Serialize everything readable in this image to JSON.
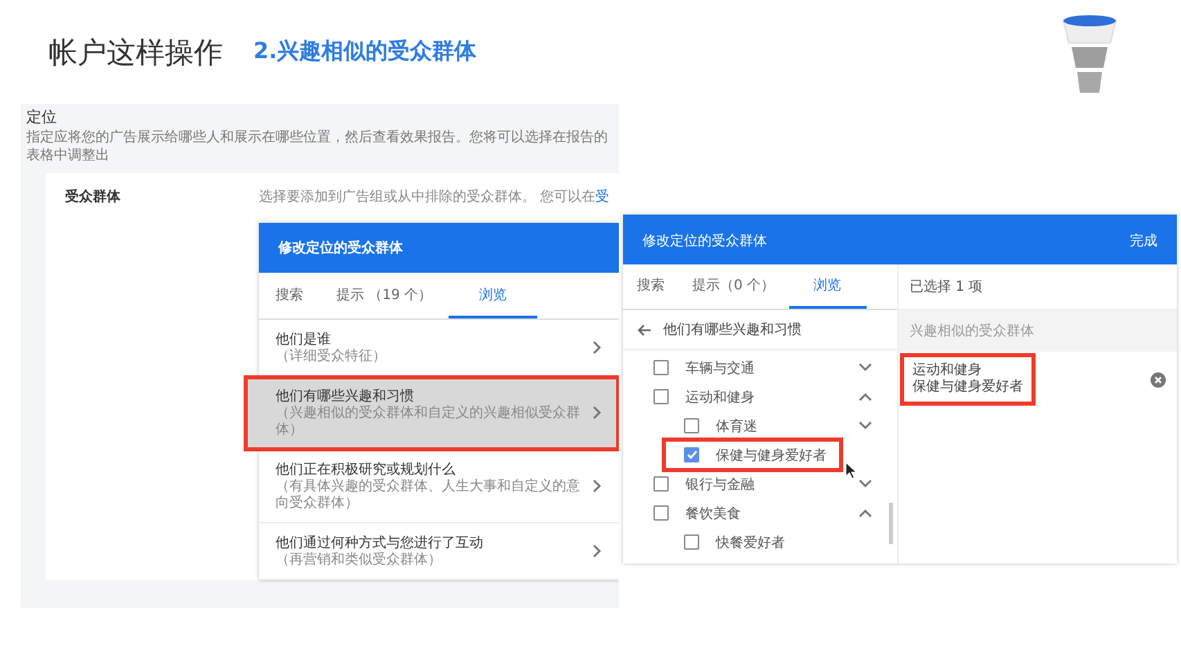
{
  "slide": {
    "title": "帐户这样操作",
    "subtitle": "2.兴趣相似的受众群体"
  },
  "targeting": {
    "section_title": "定位",
    "description": "指定应将您的广告展示给哪些人和展示在哪些位置，然后查看效果报告。您将可以选择在报告的表格中调整出",
    "field_label": "受众群体",
    "hint": "选择要添加到广告组或从中排除的受众群体。 您可以在",
    "hint_link": "受"
  },
  "panel1": {
    "title": "修改定位的受众群体",
    "tabs": [
      {
        "label": "搜索",
        "selected": false
      },
      {
        "label": "提示 （19 个）",
        "selected": false
      },
      {
        "label": "浏览",
        "selected": true
      }
    ],
    "items": [
      {
        "title": "他们是谁",
        "subtitle": "（详细受众特征）",
        "highlighted": false
      },
      {
        "title": "他们有哪些兴趣和习惯",
        "subtitle": "（兴趣相似的受众群体和自定义的兴趣相似受众群体）",
        "highlighted": true
      },
      {
        "title": "他们正在积极研究或规划什么",
        "subtitle": "（有具体兴趣的受众群体、人生大事和自定义的意向受众群体）",
        "highlighted": false
      },
      {
        "title": "他们通过何种方式与您进行了互动",
        "subtitle": "（再营销和类似受众群体）",
        "highlighted": false
      }
    ]
  },
  "panel2": {
    "title": "修改定位的受众群体",
    "action": "完成",
    "tabs": [
      {
        "label": "搜索",
        "selected": false
      },
      {
        "label": "提示（0 个）",
        "selected": false
      },
      {
        "label": "浏览",
        "selected": true
      }
    ],
    "back_label": "他们有哪些兴趣和习惯",
    "tree": [
      {
        "label": "车辆与交通",
        "checked": false,
        "expanded": false
      },
      {
        "label": "运动和健身",
        "checked": false,
        "expanded": true,
        "children": [
          {
            "label": "体育迷",
            "checked": false,
            "expanded": false
          },
          {
            "label": "保健与健身爱好者",
            "checked": true,
            "highlighted": true
          }
        ]
      },
      {
        "label": "银行与金融",
        "checked": false,
        "expanded": false
      },
      {
        "label": "餐饮美食",
        "checked": false,
        "expanded": true,
        "children": [
          {
            "label": "快餐爱好者",
            "checked": false
          }
        ]
      }
    ],
    "selected_count": "已选择 1 项",
    "group_label": "兴趣相似的受众群体",
    "selections": [
      {
        "category": "运动和健身",
        "label": "保健与健身爱好者",
        "highlighted": true
      }
    ]
  }
}
